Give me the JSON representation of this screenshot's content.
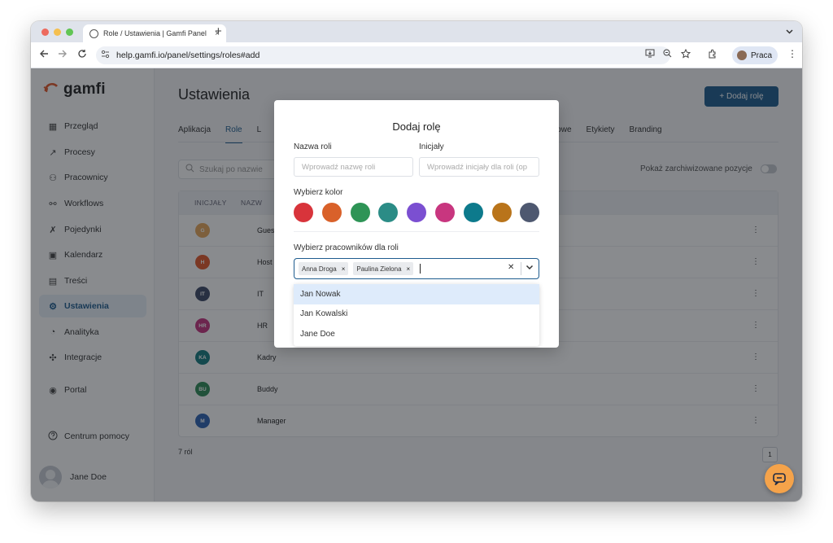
{
  "browser": {
    "tab_title": "Role / Ustawienia | Gamfi Panel",
    "tab_close": "×",
    "new_tab": "+",
    "url": "help.gamfi.io/panel/settings/roles#add",
    "profile_label": "Praca"
  },
  "sidebar": {
    "logo_text": "gamfi",
    "items": [
      {
        "label": "Przegląd",
        "icon": "grid-icon"
      },
      {
        "label": "Procesy",
        "icon": "route-icon"
      },
      {
        "label": "Pracownicy",
        "icon": "users-icon"
      },
      {
        "label": "Workflows",
        "icon": "workflow-icon"
      },
      {
        "label": "Pojedynki",
        "icon": "swords-icon"
      },
      {
        "label": "Kalendarz",
        "icon": "calendar-icon"
      },
      {
        "label": "Treści",
        "icon": "clipboard-icon"
      },
      {
        "label": "Ustawienia",
        "icon": "gear-icon",
        "active": true
      },
      {
        "label": "Analityka",
        "icon": "chart-icon"
      },
      {
        "label": "Integracje",
        "icon": "puzzle-icon"
      },
      {
        "label": "Portal",
        "icon": "user-circle-icon"
      }
    ],
    "help_label": "Centrum pomocy",
    "user_name": "Jane Doe"
  },
  "page": {
    "title": "Ustawienia",
    "add_button": "+ Dodaj rolę",
    "tabs": [
      "Aplikacja",
      "Role",
      "L",
      "dardowe",
      "Etykiety",
      "Branding"
    ],
    "active_tab": "Role",
    "search_placeholder": "Szukaj po nazwie",
    "archive_label": "Pokaż zarchiwizowane pozycje",
    "table_headers": [
      "INICJAŁY",
      "NAZW"
    ],
    "rows": [
      {
        "ini": "G",
        "name": "Guest",
        "color": "#e6a75a"
      },
      {
        "ini": "H",
        "name": "Host",
        "color": "#e2592a"
      },
      {
        "ini": "IT",
        "name": "IT",
        "color": "#3c4866"
      },
      {
        "ini": "HR",
        "name": "HR",
        "color": "#c4327f"
      },
      {
        "ini": "KA",
        "name": "Kadry",
        "color": "#157a7f"
      },
      {
        "ini": "BU",
        "name": "Buddy",
        "color": "#2e8b57"
      },
      {
        "ini": "M",
        "name": "Manager",
        "color": "#2d63b3"
      }
    ],
    "row_menu": "⋮",
    "count_label": "7 ról",
    "page_number": "1"
  },
  "modal": {
    "title": "Dodaj rolę",
    "name_label": "Nazwa roli",
    "name_placeholder": "Wprowadź nazwę roli",
    "initials_label": "Inicjały",
    "initials_placeholder": "Wprowadź inicjały dla roli (op",
    "color_label": "Wybierz kolor",
    "colors": [
      "#d8343b",
      "#d9612a",
      "#2e9456",
      "#2b8c86",
      "#7b4fd1",
      "#c8367f",
      "#0d7a8c",
      "#b9741b",
      "#4e5870"
    ],
    "employees_label": "Wybierz pracowników dla roli",
    "selected": [
      "Anna Droga",
      "Paulina Zielona"
    ],
    "chip_remove": "×",
    "clear": "✕",
    "options": [
      "Jan Nowak",
      "Jan Kowalski",
      "Jane Doe"
    ],
    "highlighted_option": "Jan Nowak"
  }
}
